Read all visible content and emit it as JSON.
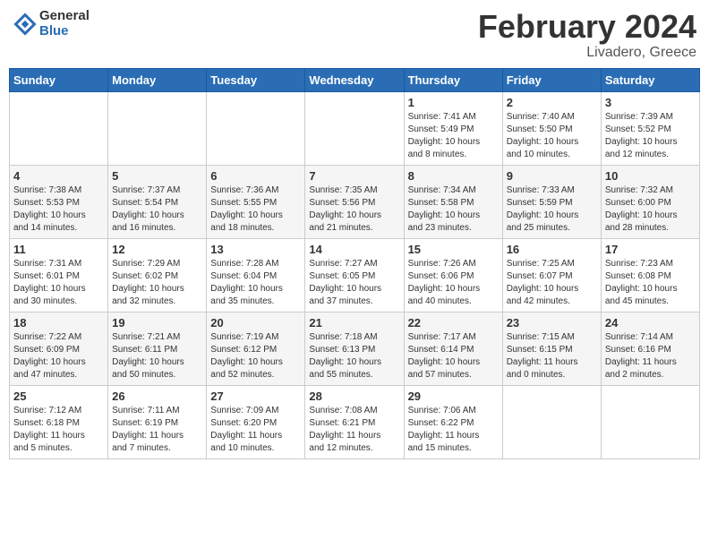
{
  "header": {
    "logo_general": "General",
    "logo_blue": "Blue",
    "title": "February 2024",
    "location": "Livadero, Greece"
  },
  "days_of_week": [
    "Sunday",
    "Monday",
    "Tuesday",
    "Wednesday",
    "Thursday",
    "Friday",
    "Saturday"
  ],
  "weeks": [
    [
      {
        "day": "",
        "info": ""
      },
      {
        "day": "",
        "info": ""
      },
      {
        "day": "",
        "info": ""
      },
      {
        "day": "",
        "info": ""
      },
      {
        "day": "1",
        "info": "Sunrise: 7:41 AM\nSunset: 5:49 PM\nDaylight: 10 hours\nand 8 minutes."
      },
      {
        "day": "2",
        "info": "Sunrise: 7:40 AM\nSunset: 5:50 PM\nDaylight: 10 hours\nand 10 minutes."
      },
      {
        "day": "3",
        "info": "Sunrise: 7:39 AM\nSunset: 5:52 PM\nDaylight: 10 hours\nand 12 minutes."
      }
    ],
    [
      {
        "day": "4",
        "info": "Sunrise: 7:38 AM\nSunset: 5:53 PM\nDaylight: 10 hours\nand 14 minutes."
      },
      {
        "day": "5",
        "info": "Sunrise: 7:37 AM\nSunset: 5:54 PM\nDaylight: 10 hours\nand 16 minutes."
      },
      {
        "day": "6",
        "info": "Sunrise: 7:36 AM\nSunset: 5:55 PM\nDaylight: 10 hours\nand 18 minutes."
      },
      {
        "day": "7",
        "info": "Sunrise: 7:35 AM\nSunset: 5:56 PM\nDaylight: 10 hours\nand 21 minutes."
      },
      {
        "day": "8",
        "info": "Sunrise: 7:34 AM\nSunset: 5:58 PM\nDaylight: 10 hours\nand 23 minutes."
      },
      {
        "day": "9",
        "info": "Sunrise: 7:33 AM\nSunset: 5:59 PM\nDaylight: 10 hours\nand 25 minutes."
      },
      {
        "day": "10",
        "info": "Sunrise: 7:32 AM\nSunset: 6:00 PM\nDaylight: 10 hours\nand 28 minutes."
      }
    ],
    [
      {
        "day": "11",
        "info": "Sunrise: 7:31 AM\nSunset: 6:01 PM\nDaylight: 10 hours\nand 30 minutes."
      },
      {
        "day": "12",
        "info": "Sunrise: 7:29 AM\nSunset: 6:02 PM\nDaylight: 10 hours\nand 32 minutes."
      },
      {
        "day": "13",
        "info": "Sunrise: 7:28 AM\nSunset: 6:04 PM\nDaylight: 10 hours\nand 35 minutes."
      },
      {
        "day": "14",
        "info": "Sunrise: 7:27 AM\nSunset: 6:05 PM\nDaylight: 10 hours\nand 37 minutes."
      },
      {
        "day": "15",
        "info": "Sunrise: 7:26 AM\nSunset: 6:06 PM\nDaylight: 10 hours\nand 40 minutes."
      },
      {
        "day": "16",
        "info": "Sunrise: 7:25 AM\nSunset: 6:07 PM\nDaylight: 10 hours\nand 42 minutes."
      },
      {
        "day": "17",
        "info": "Sunrise: 7:23 AM\nSunset: 6:08 PM\nDaylight: 10 hours\nand 45 minutes."
      }
    ],
    [
      {
        "day": "18",
        "info": "Sunrise: 7:22 AM\nSunset: 6:09 PM\nDaylight: 10 hours\nand 47 minutes."
      },
      {
        "day": "19",
        "info": "Sunrise: 7:21 AM\nSunset: 6:11 PM\nDaylight: 10 hours\nand 50 minutes."
      },
      {
        "day": "20",
        "info": "Sunrise: 7:19 AM\nSunset: 6:12 PM\nDaylight: 10 hours\nand 52 minutes."
      },
      {
        "day": "21",
        "info": "Sunrise: 7:18 AM\nSunset: 6:13 PM\nDaylight: 10 hours\nand 55 minutes."
      },
      {
        "day": "22",
        "info": "Sunrise: 7:17 AM\nSunset: 6:14 PM\nDaylight: 10 hours\nand 57 minutes."
      },
      {
        "day": "23",
        "info": "Sunrise: 7:15 AM\nSunset: 6:15 PM\nDaylight: 11 hours\nand 0 minutes."
      },
      {
        "day": "24",
        "info": "Sunrise: 7:14 AM\nSunset: 6:16 PM\nDaylight: 11 hours\nand 2 minutes."
      }
    ],
    [
      {
        "day": "25",
        "info": "Sunrise: 7:12 AM\nSunset: 6:18 PM\nDaylight: 11 hours\nand 5 minutes."
      },
      {
        "day": "26",
        "info": "Sunrise: 7:11 AM\nSunset: 6:19 PM\nDaylight: 11 hours\nand 7 minutes."
      },
      {
        "day": "27",
        "info": "Sunrise: 7:09 AM\nSunset: 6:20 PM\nDaylight: 11 hours\nand 10 minutes."
      },
      {
        "day": "28",
        "info": "Sunrise: 7:08 AM\nSunset: 6:21 PM\nDaylight: 11 hours\nand 12 minutes."
      },
      {
        "day": "29",
        "info": "Sunrise: 7:06 AM\nSunset: 6:22 PM\nDaylight: 11 hours\nand 15 minutes."
      },
      {
        "day": "",
        "info": ""
      },
      {
        "day": "",
        "info": ""
      }
    ]
  ]
}
